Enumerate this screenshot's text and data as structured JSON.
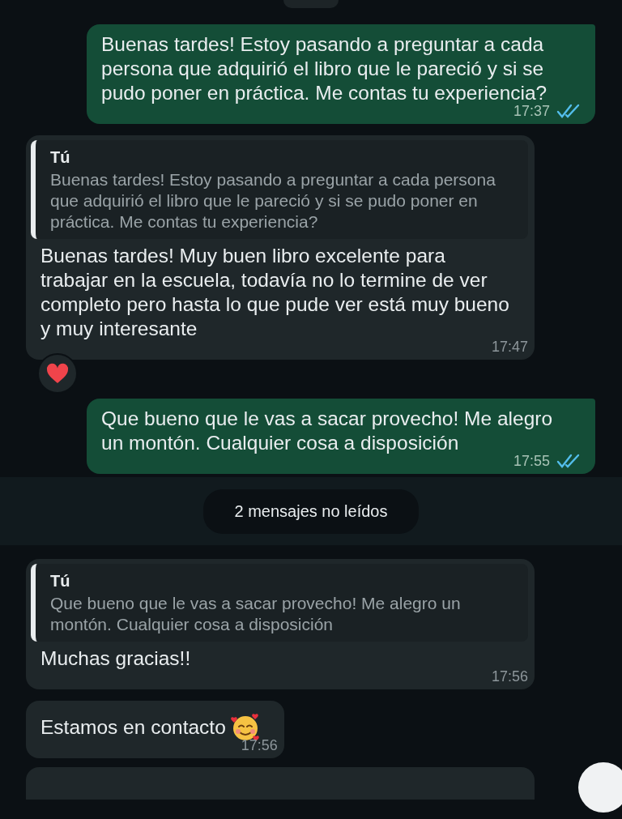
{
  "messages": [
    {
      "kind": "sent",
      "text": "Buenas tardes! Estoy pasando a preguntar a cada persona que adquirió el libro que le pareció y si se pudo poner en práctica.  Me contas tu experiencia?",
      "time": "17:37",
      "read": true
    },
    {
      "kind": "received",
      "quote": {
        "author": "Tú",
        "text": "Buenas tardes! Estoy pasando a preguntar a cada persona que adquirió el libro que le pareció y si se pudo poner en práctica.  Me contas tu experiencia?"
      },
      "text": "Buenas tardes! Muy buen libro excelente para trabajar en la escuela, todavía no lo termine de ver completo pero hasta lo que pude ver está muy bueno y muy interesante",
      "time": "17:47",
      "hearted": true
    },
    {
      "kind": "sent",
      "text": "Que bueno que le vas a sacar provecho! Me alegro un montón. Cualquier cosa a disposición",
      "time": "17:55",
      "read": true
    },
    {
      "kind": "unread_banner",
      "text": "2 mensajes no leídos"
    },
    {
      "kind": "received",
      "quote": {
        "author": "Tú",
        "text": "Que bueno que le vas a sacar provecho! Me alegro un montón. Cualquier cosa a disposición"
      },
      "text": "Muchas gracias!!",
      "time": "17:56"
    },
    {
      "kind": "received",
      "text": "Estamos en contacto",
      "face_emoji": true,
      "time": "17:56"
    }
  ]
}
